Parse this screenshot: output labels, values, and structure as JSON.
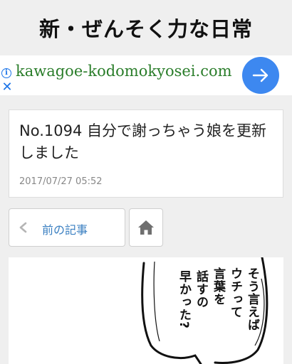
{
  "header": {
    "title": "新・ぜんそく力な日常"
  },
  "ad": {
    "url_text": "kawagoe-kodomokyosei.com",
    "info_glyph": "i",
    "close_glyph": "✕",
    "accent_color": "#3d88f0",
    "url_color": "#2a7d2a",
    "icons": [
      "info-icon",
      "close-icon",
      "arrow-right-icon"
    ]
  },
  "article": {
    "title": "No.1094 自分で謝っちゃう娘を更新しました",
    "date": "2017/07/27 05:52"
  },
  "navigation": {
    "prev_label": "前の記事",
    "icons": [
      "chevron-left-icon",
      "home-icon"
    ],
    "link_color": "#3a7fc1"
  },
  "manga": {
    "speech_lines": [
      "そう言えば",
      "ウチって",
      "言葉を",
      "話すの",
      "早かった?"
    ]
  }
}
